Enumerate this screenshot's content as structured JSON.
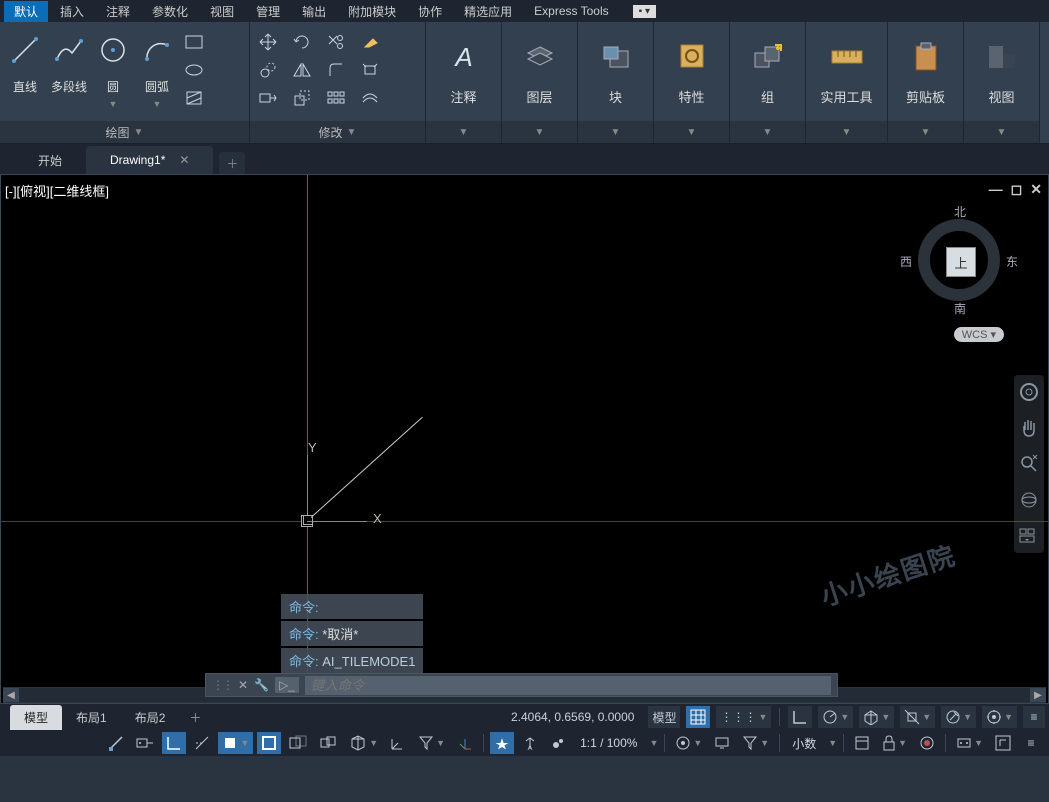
{
  "menu": {
    "items": [
      "默认",
      "插入",
      "注释",
      "参数化",
      "视图",
      "管理",
      "输出",
      "附加模块",
      "协作",
      "精选应用",
      "Express Tools"
    ],
    "active_index": 0
  },
  "ribbon": {
    "draw_panel": {
      "footer": "绘图",
      "tools": [
        {
          "label": "直线"
        },
        {
          "label": "多段线"
        },
        {
          "label": "圆"
        },
        {
          "label": "圆弧"
        }
      ]
    },
    "modify_panel": {
      "footer": "修改"
    },
    "panels": [
      {
        "label": "注释"
      },
      {
        "label": "图层"
      },
      {
        "label": "块"
      },
      {
        "label": "特性"
      },
      {
        "label": "组"
      },
      {
        "label": "实用工具"
      },
      {
        "label": "剪贴板"
      },
      {
        "label": "视图"
      }
    ]
  },
  "tabs": {
    "start": "开始",
    "drawing": "Drawing1*"
  },
  "viewport": {
    "label": "[-][俯视][二维线框]",
    "axis_x": "X",
    "axis_y": "Y"
  },
  "viewcube": {
    "face": "上",
    "n": "北",
    "s": "南",
    "w": "西",
    "e": "东",
    "wcs": "WCS"
  },
  "watermark": "小小绘图院",
  "command_log": [
    {
      "prefix": "命令:",
      "text": ""
    },
    {
      "prefix": "命令:",
      "text": "*取消*"
    },
    {
      "prefix": "命令:",
      "text": "AI_TILEMODE1"
    }
  ],
  "command_input": {
    "placeholder": "键入命令"
  },
  "layout_tabs": {
    "items": [
      "模型",
      "布局1",
      "布局2"
    ],
    "active_index": 0
  },
  "status": {
    "coords": "2.4064, 0.6569, 0.0000",
    "model_btn": "模型",
    "scale": "1:1 / 100%",
    "units": "小数"
  }
}
